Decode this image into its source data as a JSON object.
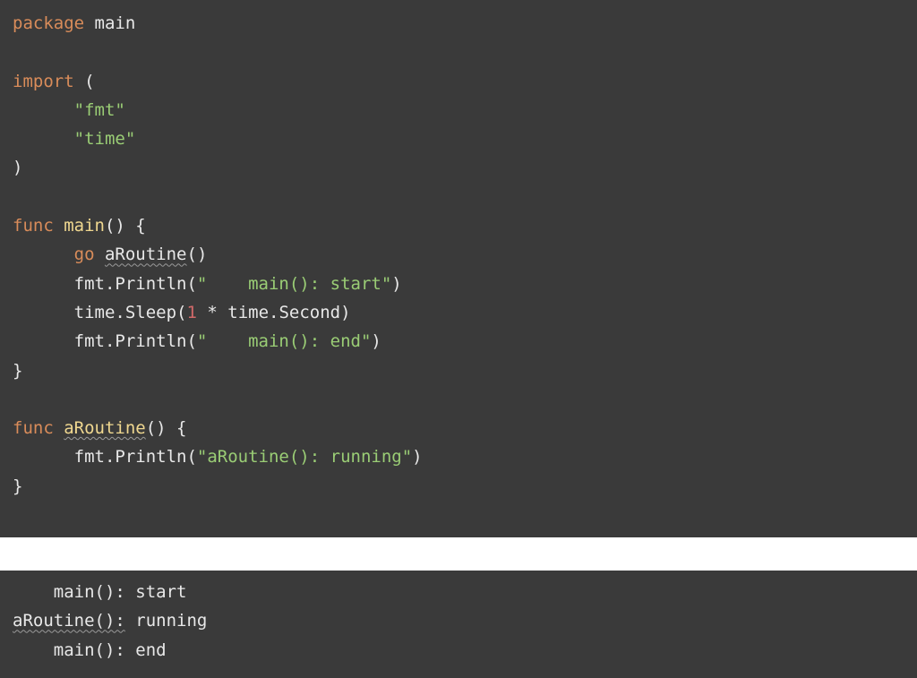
{
  "code": {
    "line1": {
      "kw": "package",
      "sp": " ",
      "ident": "main"
    },
    "line2": "",
    "line3": {
      "kw": "import",
      "rest": " ("
    },
    "line4": {
      "indent": "      ",
      "str": "\"fmt\""
    },
    "line5": {
      "indent": "      ",
      "str": "\"time\""
    },
    "line6": ")",
    "line7": "",
    "line8": {
      "kw": "func",
      "sp": " ",
      "fname": "main",
      "rest": "() {"
    },
    "line9": {
      "indent": "      ",
      "kw": "go",
      "sp": " ",
      "call": "aRoutine",
      "rest": "()"
    },
    "line10": {
      "indent": "      ",
      "prefix": "fmt.Println(",
      "str": "\"    main(): start\"",
      "suffix": ")"
    },
    "line11": {
      "indent": "      ",
      "prefix": "time.Sleep(",
      "num": "1",
      "mid": " * time.Second)",
      "suffix": ""
    },
    "line12": {
      "indent": "      ",
      "prefix": "fmt.Println(",
      "str": "\"    main(): end\"",
      "suffix": ")"
    },
    "line13": "}",
    "line14": "",
    "line15": {
      "kw": "func",
      "sp": " ",
      "fname": "aRoutine",
      "rest": "() {"
    },
    "line16": {
      "indent": "      ",
      "prefix": "fmt.Println(",
      "str": "\"aRoutine(): running\"",
      "suffix": ")"
    },
    "line17": "}"
  },
  "output": {
    "line1": "    main(): start",
    "line2_a": "aRoutine():",
    "line2_b": " running",
    "line3": "    main(): end"
  }
}
